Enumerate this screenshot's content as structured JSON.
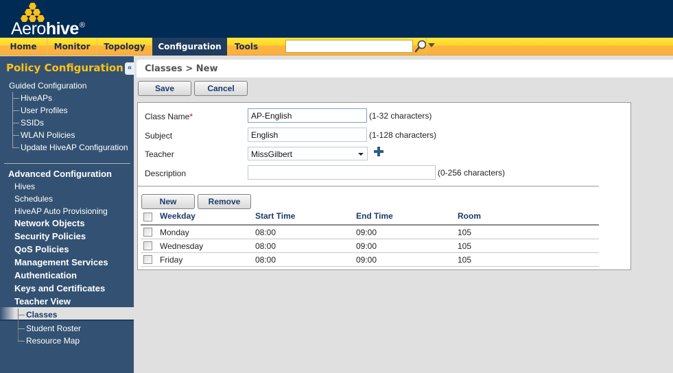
{
  "app": {
    "brand_prefix": "Aero",
    "brand_bold": "hive",
    "brand_mark": "®"
  },
  "nav": {
    "tabs": [
      {
        "label": "Home",
        "active": false
      },
      {
        "label": "Monitor",
        "active": false
      },
      {
        "label": "Topology",
        "active": false
      },
      {
        "label": "Configuration",
        "active": true
      },
      {
        "label": "Tools",
        "active": false
      }
    ],
    "search": {
      "value": "",
      "placeholder": ""
    }
  },
  "sidebar": {
    "title": "Policy Configuration",
    "collapse_label": "«",
    "guided": {
      "label": "Guided Configuration",
      "items": [
        "HiveAPs",
        "User Profiles",
        "SSIDs",
        "WLAN Policies",
        "Update HiveAP Configuration"
      ]
    },
    "advanced": {
      "label": "Advanced Configuration",
      "items": [
        {
          "label": "Hives",
          "bold": false
        },
        {
          "label": "Schedules",
          "bold": false
        },
        {
          "label": "HiveAP Auto Provisioning",
          "bold": false
        },
        {
          "label": "Network Objects",
          "bold": true
        },
        {
          "label": "Security Policies",
          "bold": true
        },
        {
          "label": "QoS Policies",
          "bold": true
        },
        {
          "label": "Management Services",
          "bold": true
        },
        {
          "label": "Authentication",
          "bold": true
        },
        {
          "label": "Keys and Certificates",
          "bold": true
        },
        {
          "label": "Teacher View",
          "bold": true
        }
      ],
      "teacher_view_items": [
        {
          "label": "Classes",
          "selected": true
        },
        {
          "label": "Student Roster",
          "selected": false
        },
        {
          "label": "Resource Map",
          "selected": false
        }
      ]
    }
  },
  "main": {
    "breadcrumb": "Classes > New",
    "toolbar": {
      "save_label": "Save",
      "cancel_label": "Cancel"
    },
    "form": {
      "class_name": {
        "label": "Class Name",
        "required_mark": "*",
        "value": "AP-English",
        "hint": "(1-32 characters)"
      },
      "subject": {
        "label": "Subject",
        "value": "English",
        "hint": "(1-128 characters)"
      },
      "teacher": {
        "label": "Teacher",
        "value": "MissGilbert"
      },
      "description": {
        "label": "Description",
        "value": "",
        "hint": "(0-256 characters)"
      }
    },
    "schedule": {
      "new_label": "New",
      "remove_label": "Remove",
      "columns": [
        "Weekday",
        "Start Time",
        "End Time",
        "Room"
      ],
      "rows": [
        {
          "weekday": "Monday",
          "start": "08:00",
          "end": "09:00",
          "room": "105",
          "checked": false
        },
        {
          "weekday": "Wednesday",
          "start": "08:00",
          "end": "09:00",
          "room": "105",
          "checked": false
        },
        {
          "weekday": "Friday",
          "start": "08:00",
          "end": "09:00",
          "room": "105",
          "checked": false
        }
      ]
    }
  },
  "colors": {
    "header_bg": "#002b54",
    "nav_yellow": "#ffd72c",
    "nav_active": "#203c5e",
    "sidebar_bg": "#335273",
    "sidebar_title": "#fcc217",
    "logo_hex": "#fcbf16"
  }
}
